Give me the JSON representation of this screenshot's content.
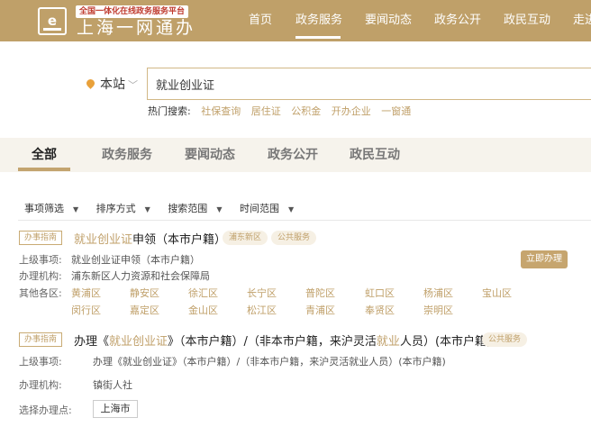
{
  "header": {
    "logo_subtitle": "全国一体化在线政务服务平台",
    "logo_title": "上海一网通办",
    "nav": [
      {
        "label": "首页"
      },
      {
        "label": "政务服务"
      },
      {
        "label": "要闻动态"
      },
      {
        "label": "政务公开"
      },
      {
        "label": "政民互动"
      },
      {
        "label": "走进"
      }
    ],
    "active_nav": "政务服务",
    "accent_color": "#bfa069"
  },
  "search": {
    "location": "本站",
    "query": "就业创业证",
    "hot_label": "热门搜索:",
    "hot_terms": [
      "社保查询",
      "居住证",
      "公积金",
      "开办企业",
      "一窗通"
    ]
  },
  "tabs": [
    {
      "label": "全部"
    },
    {
      "label": "政务服务"
    },
    {
      "label": "要闻动态"
    },
    {
      "label": "政务公开"
    },
    {
      "label": "政民互动"
    }
  ],
  "active_tab": "全部",
  "filters": [
    "事项筛选",
    "排序方式",
    "搜索范围",
    "时间范围"
  ],
  "results": [
    {
      "badge": "办事指南",
      "title_highlight": "就业创业证",
      "title_rest": "申领（本市户籍）",
      "tags": [
        "浦东新区",
        "公共服务"
      ],
      "parent_label": "上级事项:",
      "parent_value": "就业创业证申领（本市户籍）",
      "org_label": "办理机构:",
      "org_value": "浦东新区人力资源和社会保障局",
      "action": "立即办理",
      "other_label": "其他各区:",
      "districts": [
        "黄浦区",
        "静安区",
        "徐汇区",
        "长宁区",
        "普陀区",
        "虹口区",
        "杨浦区",
        "宝山区",
        "闵行区",
        "嘉定区",
        "金山区",
        "松江区",
        "青浦区",
        "奉贤区",
        "崇明区"
      ]
    },
    {
      "badge": "办事指南",
      "title_pre": "办理《",
      "title_hl1": "就业创业证",
      "title_mid": "》（本市户籍）/（非本市户籍，来沪灵活",
      "title_hl2": "就业",
      "title_post": "人员）(本市户籍)",
      "tags": [
        "公共服务"
      ],
      "parent_label": "上级事项:",
      "parent_value": "办理《就业创业证》（本市户籍）/（非本市户籍，来沪灵活就业人员）(本市户籍)",
      "org_label": "办理机构:",
      "org_value": "镇街人社",
      "site_label": "选择办理点:",
      "site_value": "上海市"
    }
  ]
}
